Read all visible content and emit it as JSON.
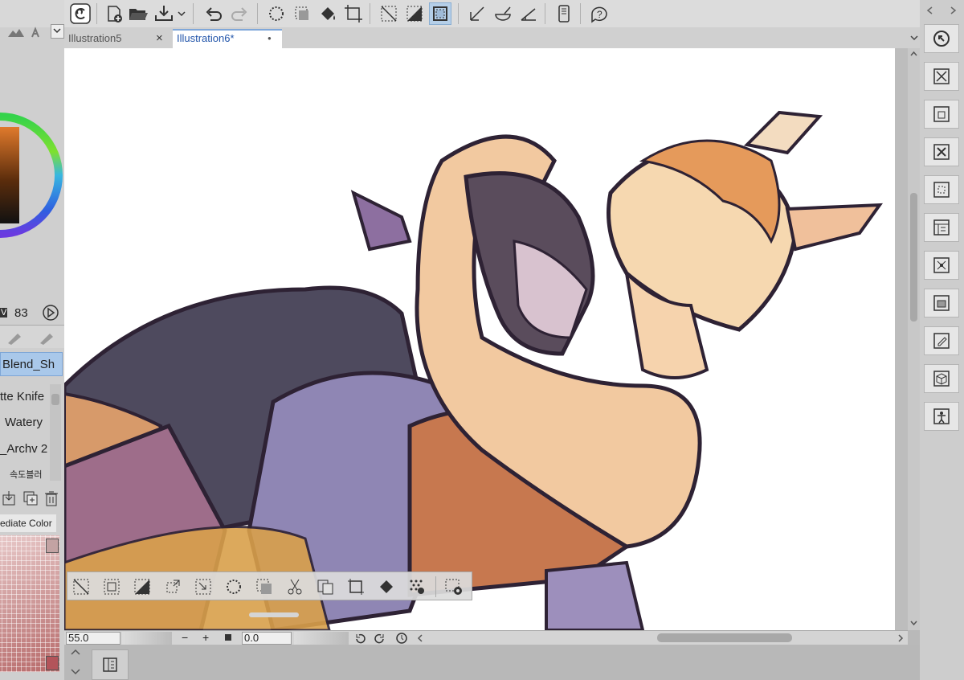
{
  "tabs": [
    {
      "label": "Illustration5",
      "close": "×"
    },
    {
      "label": "Illustration6*",
      "modified_dot": "●"
    }
  ],
  "left_panel": {
    "value_label": "V",
    "value": "83",
    "brushes": [
      "Blend_Sh",
      "tte Knife",
      "Watery",
      "_Archv 2",
      "속도블러"
    ],
    "sub_tool_label": "ediate Color"
  },
  "status": {
    "zoom": "55.0",
    "minus": "−",
    "plus": "+",
    "rotation": "0.0"
  },
  "colors": {
    "accent": "#7fa7d9",
    "selected_tool_bg": "#b5cfe8",
    "canvas_bg": "#ffffff",
    "panel_bg": "#cfcfcf"
  },
  "icons": {
    "top_toolbar": [
      "app-logo-icon",
      "new-canvas-icon",
      "open-file-icon",
      "save-icon",
      "dropdown-arrow-icon",
      "undo-icon",
      "redo-icon",
      "lasso-selection-icon",
      "selection-layer-icon",
      "fill-icon",
      "transform-icon",
      "clear-selection-icon",
      "invert-selection-icon",
      "show-selection-area-icon",
      "ruler-snap-icon",
      "special-ruler-icon",
      "grid-snap-icon",
      "smartphone-icon",
      "help-icon"
    ],
    "right_panel": [
      "navigator-icon",
      "close-panel-icon",
      "layer-property-icon",
      "close-icon",
      "material-icon",
      "sub-view-icon",
      "tool-property-icon",
      "layer-icon",
      "edit-icon",
      "3d-icon",
      "character-icon"
    ],
    "selection_bar": [
      "deselect-icon",
      "invert-icon",
      "select-all-icon",
      "transform-selection-icon",
      "shrink-selection-icon",
      "expand-selection-icon",
      "convert-selection-icon",
      "cut-icon",
      "copy-paste-icon",
      "scale-icon",
      "fill-selection-icon",
      "screentone-icon",
      "selection-settings-icon"
    ]
  }
}
